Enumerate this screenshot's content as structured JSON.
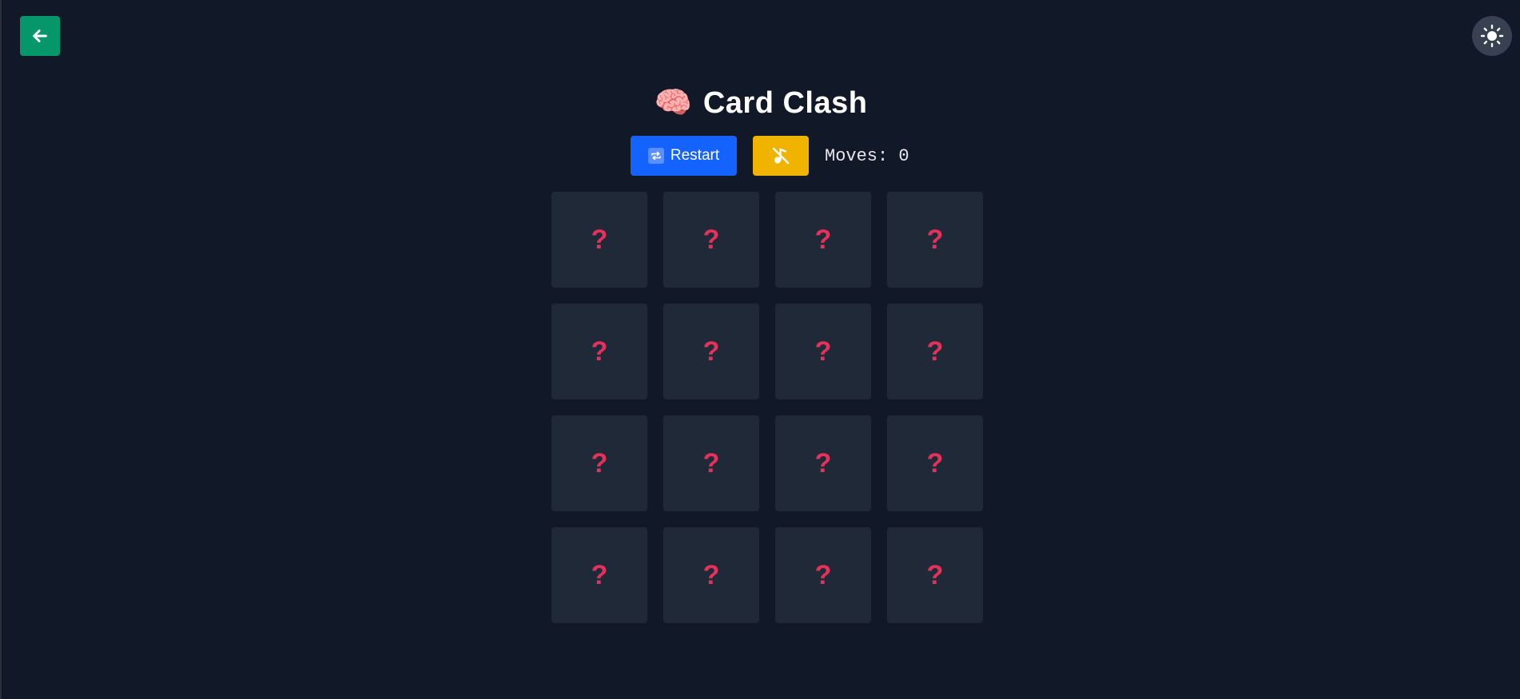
{
  "header": {
    "back_icon": "arrow-left-icon",
    "theme_icon": "sun-icon",
    "title_emoji": "🧠",
    "title": "Card Clash"
  },
  "controls": {
    "restart_icon": "repeat-icon",
    "restart_label": "Restart",
    "mute_icon": "music-off-icon",
    "moves_text": "Moves: 0"
  },
  "colors": {
    "background": "#111827",
    "card": "#1f2937",
    "back_button": "#059669",
    "restart_button": "#1463ff",
    "mute_button": "#f0b400",
    "card_symbol": "#e8315a"
  },
  "board": {
    "cards": [
      {
        "face": "?"
      },
      {
        "face": "?"
      },
      {
        "face": "?"
      },
      {
        "face": "?"
      },
      {
        "face": "?"
      },
      {
        "face": "?"
      },
      {
        "face": "?"
      },
      {
        "face": "?"
      },
      {
        "face": "?"
      },
      {
        "face": "?"
      },
      {
        "face": "?"
      },
      {
        "face": "?"
      },
      {
        "face": "?"
      },
      {
        "face": "?"
      },
      {
        "face": "?"
      },
      {
        "face": "?"
      }
    ]
  }
}
